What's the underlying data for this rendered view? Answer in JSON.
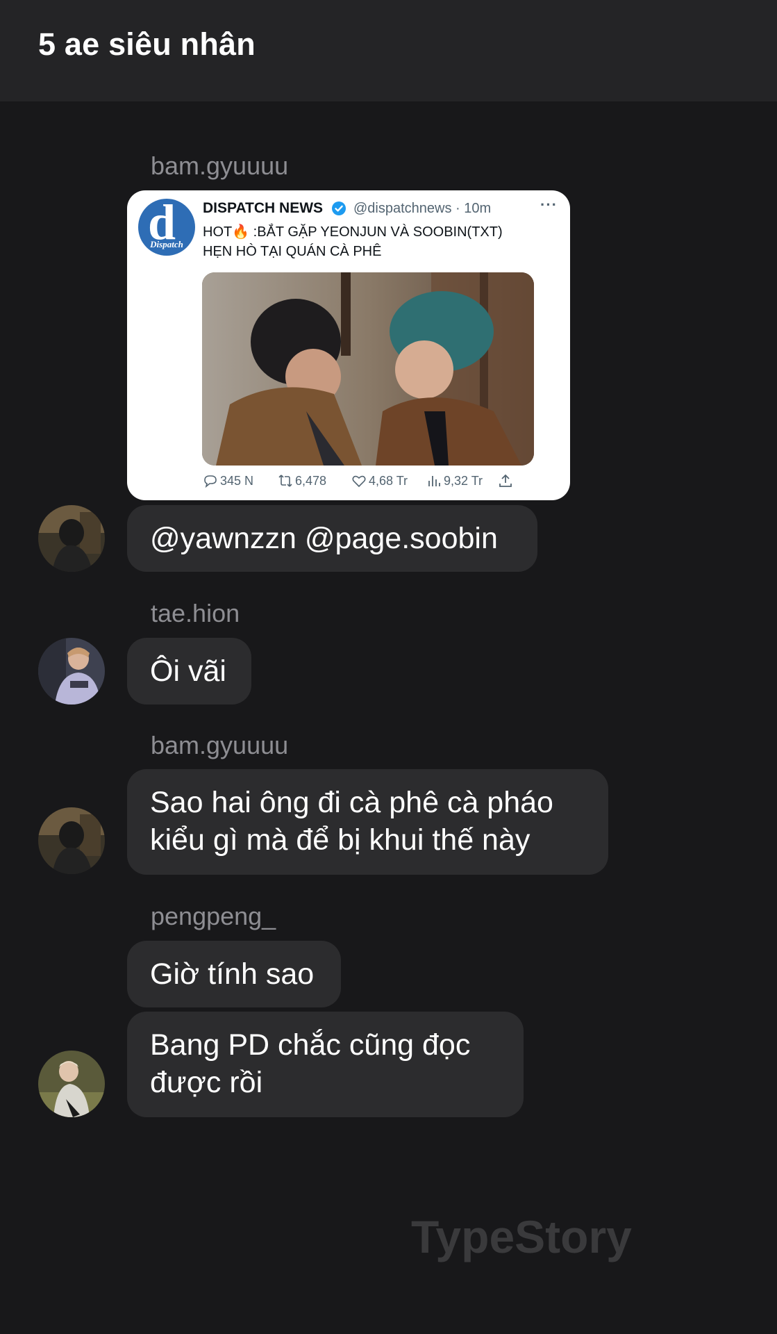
{
  "chat": {
    "title": "5 ae siêu nhân"
  },
  "tweet": {
    "name": "DISPATCH NEWS",
    "handle_time": "@dispatchnews · 10m",
    "more": "···",
    "text_line1": "HOT🔥 :BẮT GẶP YEONJUN VÀ SOOBIN(TXT)",
    "text_line2": "HẸN HÒ TẠI QUÁN CÀ PHÊ",
    "logo_letter": "d",
    "logo_word": "Dispatch",
    "replies": "345 N",
    "retweets": "6,478",
    "likes": "4,68 Tr",
    "views": "9,32 Tr"
  },
  "messages": [
    {
      "sender": "bam.gyuuuu",
      "lines": [
        "@yawnzzn @page.soobin"
      ]
    },
    {
      "sender": "tae.hion",
      "lines": [
        "Ôi vãi"
      ]
    },
    {
      "sender": "bam.gyuuuu",
      "lines": [
        "Sao hai ông đi cà phê cà pháo",
        "kiểu gì mà để bị khui thế này"
      ]
    },
    {
      "sender": "pengpeng_",
      "lines": [
        "Giờ tính sao"
      ]
    },
    {
      "sender": "",
      "lines": [
        "Bang PD chắc cũng đọc",
        "được rồi"
      ]
    }
  ],
  "watermark": "TypeStory",
  "colors": {
    "background": "#18181a",
    "header": "#242426",
    "bubble": "#2c2c2e",
    "sender": "#8e8e93",
    "twitter_blue": "#1d9bf0"
  }
}
